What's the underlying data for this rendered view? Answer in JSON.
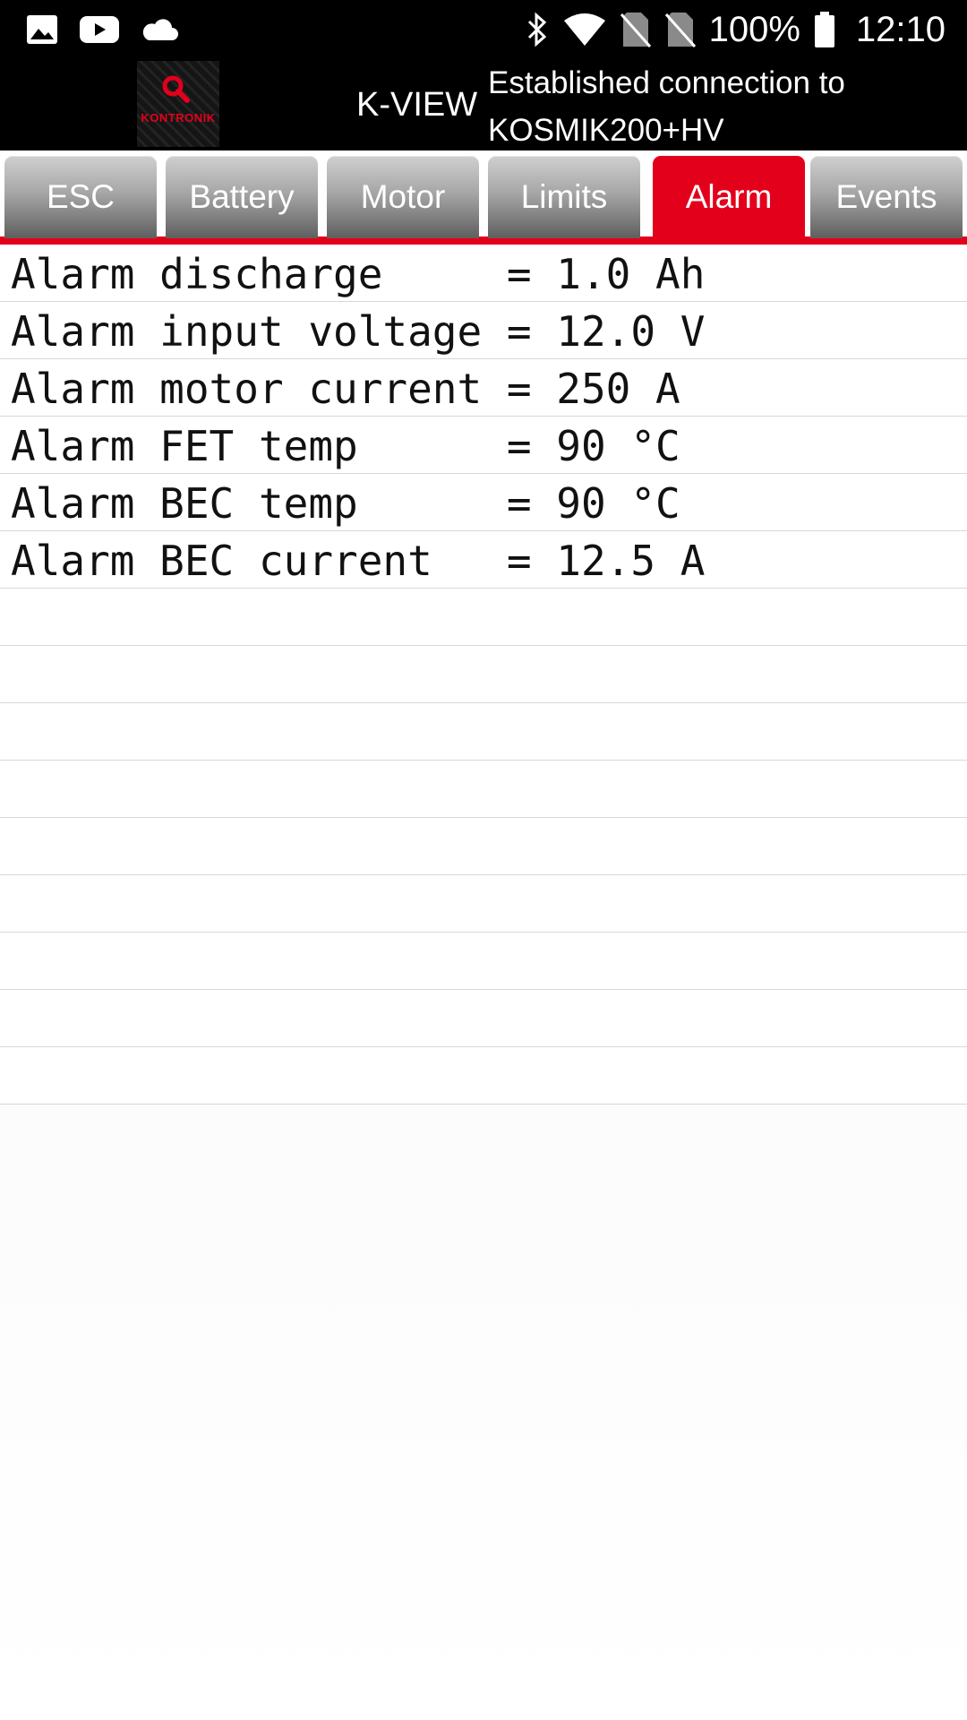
{
  "status_bar": {
    "left_icons": [
      "gallery-icon",
      "youtube-icon",
      "cloud-icon"
    ],
    "right_icons": [
      "bluetooth-icon",
      "wifi-icon",
      "no-sim-icon",
      "no-sim-icon",
      "battery-icon"
    ],
    "battery": "100%",
    "time": "12:10"
  },
  "header": {
    "logo_text": "KONTRONIK",
    "app_title": "K-VIEW",
    "connection_status": "Established connection to KOSMIK200+HV"
  },
  "tabs": [
    {
      "label": "ESC",
      "active": false
    },
    {
      "label": "Battery",
      "active": false
    },
    {
      "label": "Motor",
      "active": false
    },
    {
      "label": "Limits",
      "active": false
    },
    {
      "label": "Alarm",
      "active": true
    },
    {
      "label": "Events",
      "active": false
    }
  ],
  "rows": [
    "Alarm discharge     = 1.0 Ah",
    "Alarm input voltage = 12.0 V",
    "Alarm motor current = 250 A",
    "Alarm FET temp      = 90 °C",
    "Alarm BEC temp      = 90 °C",
    "Alarm BEC current   = 12.5 A",
    "",
    "",
    "",
    "",
    "",
    "",
    "",
    "",
    ""
  ],
  "colors": {
    "accent": "#e3001b",
    "header_bg": "#000000"
  }
}
